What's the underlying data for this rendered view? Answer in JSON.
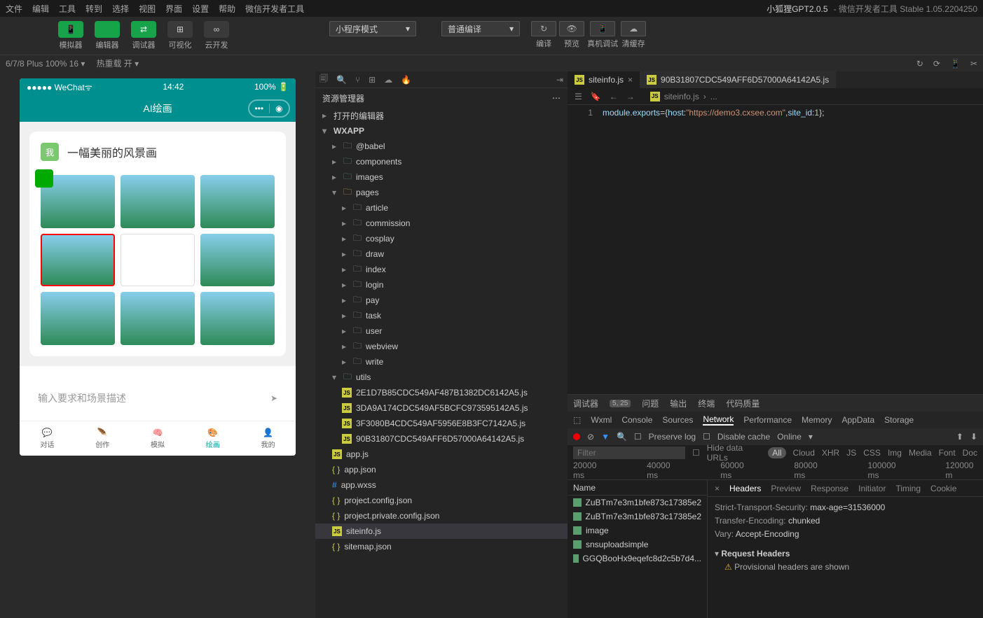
{
  "menubar": {
    "items": [
      "文件",
      "编辑",
      "工具",
      "转到",
      "选择",
      "视图",
      "界面",
      "设置",
      "帮助",
      "微信开发者工具"
    ],
    "title": "小狐狸GPT2.0.5",
    "subtitle": " - 微信开发者工具 Stable 1.05.2204250"
  },
  "toolbar": {
    "left": [
      {
        "icon": "📱",
        "label": "模拟器",
        "green": true
      },
      {
        "icon": "</>",
        "label": "编辑器",
        "green": true
      },
      {
        "icon": "⇄",
        "label": "调试器",
        "green": true
      },
      {
        "icon": "⊞",
        "label": "可视化"
      },
      {
        "icon": "∞",
        "label": "云开发"
      }
    ],
    "mode": "小程序模式",
    "compile": "普通编译",
    "right": [
      {
        "icon": "↻",
        "label": "编译"
      },
      {
        "icon": "👁",
        "label": "预览"
      },
      {
        "icon": "📱",
        "label": "真机调试"
      },
      {
        "icon": "☁",
        "label": "清缓存"
      }
    ]
  },
  "statusbar": {
    "device": "6/7/8 Plus 100% 16 ▾",
    "reload": "热重载 开 ▾"
  },
  "phone": {
    "carrier": "●●●●● WeChat",
    "signal": "ᯤ",
    "time": "14:42",
    "battery": "100%",
    "title": "AI绘画",
    "badge": "我",
    "cardTitle": "一幅美丽的风景画",
    "placeholder": "输入要求和场景描述",
    "tabs": [
      {
        "icon": "💬",
        "label": "对话"
      },
      {
        "icon": "🪶",
        "label": "创作"
      },
      {
        "icon": "🧠",
        "label": "模拟"
      },
      {
        "icon": "🎨",
        "label": "绘画",
        "active": true
      },
      {
        "icon": "👤",
        "label": "我的"
      }
    ]
  },
  "explorer": {
    "title": "资源管理器",
    "sections": [
      {
        "label": "打开的编辑器",
        "expanded": false
      }
    ],
    "root": "WXAPP",
    "tree": [
      {
        "label": "@babel",
        "type": "folder",
        "depth": 1
      },
      {
        "label": "components",
        "type": "folder",
        "depth": 1,
        "color": "#5a9e6f"
      },
      {
        "label": "images",
        "type": "folder",
        "depth": 1,
        "color": "#5a9e6f"
      },
      {
        "label": "pages",
        "type": "folder",
        "depth": 1,
        "expanded": true,
        "color": "#e6a23c"
      },
      {
        "label": "article",
        "type": "folder",
        "depth": 2
      },
      {
        "label": "commission",
        "type": "folder",
        "depth": 2
      },
      {
        "label": "cosplay",
        "type": "folder",
        "depth": 2
      },
      {
        "label": "draw",
        "type": "folder",
        "depth": 2
      },
      {
        "label": "index",
        "type": "folder",
        "depth": 2
      },
      {
        "label": "login",
        "type": "folder",
        "depth": 2
      },
      {
        "label": "pay",
        "type": "folder",
        "depth": 2
      },
      {
        "label": "task",
        "type": "folder",
        "depth": 2
      },
      {
        "label": "user",
        "type": "folder",
        "depth": 2
      },
      {
        "label": "webview",
        "type": "folder",
        "depth": 2
      },
      {
        "label": "write",
        "type": "folder",
        "depth": 2
      },
      {
        "label": "utils",
        "type": "folder",
        "depth": 1,
        "expanded": true,
        "color": "#5a9e6f"
      },
      {
        "label": "2E1D7B85CDC549AF487B1382DC6142A5.js",
        "type": "js",
        "depth": 2
      },
      {
        "label": "3DA9A174CDC549AF5BCFC973595142A5.js",
        "type": "js",
        "depth": 2
      },
      {
        "label": "3F3080B4CDC549AF5956E8B3FC7142A5.js",
        "type": "js",
        "depth": 2
      },
      {
        "label": "90B31807CDC549AFF6D57000A64142A5.js",
        "type": "js",
        "depth": 2
      },
      {
        "label": "app.js",
        "type": "js",
        "depth": 1
      },
      {
        "label": "app.json",
        "type": "json",
        "depth": 1
      },
      {
        "label": "app.wxss",
        "type": "wxss",
        "depth": 1
      },
      {
        "label": "project.config.json",
        "type": "json",
        "depth": 1
      },
      {
        "label": "project.private.config.json",
        "type": "json",
        "depth": 1
      },
      {
        "label": "siteinfo.js",
        "type": "js",
        "depth": 1,
        "selected": true
      },
      {
        "label": "sitemap.json",
        "type": "json",
        "depth": 1
      }
    ]
  },
  "editor": {
    "tabs": [
      {
        "label": "siteinfo.js",
        "active": true
      },
      {
        "label": "90B31807CDC549AFF6D57000A64142A5.js"
      }
    ],
    "breadcrumb": [
      "siteinfo.js",
      "..."
    ],
    "code": {
      "line": "1",
      "text_parts": [
        "module",
        ".",
        "exports",
        "=",
        "{",
        "host",
        ":",
        "\"https://demo3.cxsee.com\"",
        ",",
        "site_id",
        ":",
        "1",
        "};"
      ]
    }
  },
  "debugger": {
    "tabs1": [
      {
        "label": "调试器"
      },
      {
        "badge": "5, 25"
      },
      {
        "label": "问题"
      },
      {
        "label": "输出"
      },
      {
        "label": "终端"
      },
      {
        "label": "代码质量"
      }
    ],
    "tabs2": [
      "Wxml",
      "Console",
      "Sources",
      "Network",
      "Performance",
      "Memory",
      "AppData",
      "Storage"
    ],
    "activeTab2": "Network",
    "toolbar": {
      "preserve": "Preserve log",
      "disable": "Disable cache",
      "throttle": "Online"
    },
    "filter": {
      "placeholder": "Filter",
      "hideUrls": "Hide data URLs",
      "types": [
        "All",
        "Cloud",
        "XHR",
        "JS",
        "CSS",
        "Img",
        "Media",
        "Font",
        "Doc"
      ]
    },
    "timeline": [
      "20000 ms",
      "40000 ms",
      "60000 ms",
      "80000 ms",
      "100000 ms",
      "120000 m"
    ],
    "requests": {
      "header": "Name",
      "items": [
        "ZuBTm7e3m1bfe873c17385e2",
        "ZuBTm7e3m1bfe873c17385e2",
        "image",
        "snsuploadsimple",
        "GGQBooHx9eqefc8d2c5b7d4..."
      ]
    },
    "detail": {
      "tabs": [
        "Headers",
        "Preview",
        "Response",
        "Initiator",
        "Timing",
        "Cookie"
      ],
      "activeTab": "Headers",
      "headers": [
        {
          "key": "Strict-Transport-Security:",
          "val": "max-age=31536000"
        },
        {
          "key": "Transfer-Encoding:",
          "val": "chunked"
        },
        {
          "key": "Vary:",
          "val": "Accept-Encoding"
        }
      ],
      "section": "Request Headers",
      "warning": "Provisional headers are shown"
    }
  }
}
